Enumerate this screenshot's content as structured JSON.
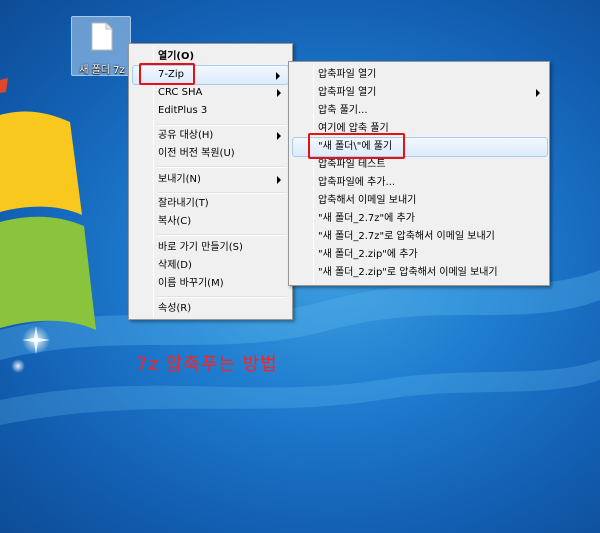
{
  "desktop": {
    "icon_label": "새 폴더 7z"
  },
  "context_menu": {
    "items": [
      {
        "label": "열기(O)",
        "bold": true
      },
      {
        "label": "7-Zip",
        "submenu": true,
        "highlighted": true
      },
      {
        "label": "CRC SHA",
        "submenu": true
      },
      {
        "label": "EditPlus 3"
      },
      {
        "label": "공유 대상(H)",
        "submenu": true
      },
      {
        "label": "이전 버전 복원(U)"
      },
      {
        "label": "보내기(N)",
        "submenu": true
      },
      {
        "label": "잘라내기(T)"
      },
      {
        "label": "복사(C)"
      },
      {
        "label": "바로 가기 만들기(S)"
      },
      {
        "label": "삭제(D)"
      },
      {
        "label": "이름 바꾸기(M)"
      },
      {
        "label": "속성(R)"
      }
    ]
  },
  "submenu_7zip": {
    "items": [
      {
        "label": "압축파일 열기"
      },
      {
        "label": "압축파일 열기",
        "submenu": true
      },
      {
        "label": "압축 풀기..."
      },
      {
        "label": "여기에 압축 풀기"
      },
      {
        "label": "\"새 폴더\\\"에 풀기",
        "highlighted": true
      },
      {
        "label": "압축파일 테스트"
      },
      {
        "label": "압축파일에 추가..."
      },
      {
        "label": "압축해서 이메일 보내기"
      },
      {
        "label": "\"새 폴더_2.7z\"에 추가"
      },
      {
        "label": "\"새 폴더_2.7z\"로 압축해서 이메일 보내기"
      },
      {
        "label": "\"새 폴더_2.zip\"에 추가"
      },
      {
        "label": "\"새 폴더_2.zip\"로 압축해서 이메일 보내기"
      }
    ]
  },
  "caption": "7z 압축푸는 방법",
  "colors": {
    "highlight_box": "#e81010",
    "caption": "#ff2020",
    "menu_bg": "#f0f0f0"
  }
}
